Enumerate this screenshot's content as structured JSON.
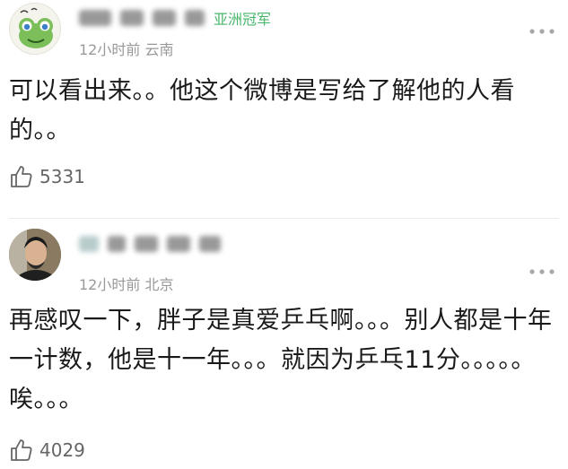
{
  "comments": [
    {
      "user_badge": "亚洲冠军",
      "time": "12小时前",
      "location": "云南",
      "text": "可以看出来。。他这个微博是写给了解他的人看的。。",
      "likes": "5331"
    },
    {
      "user_badge": "",
      "time": "12小时前",
      "location": "北京",
      "text": "再感叹一下，胖子是真爱乒乓啊。。。别人都是十年一计数，他是十一年。。。就因为乒乓11分。。。。。唉。。。",
      "likes": "4029"
    }
  ],
  "icons": {
    "more": "more-dots-icon",
    "like": "thumbs-up-icon"
  },
  "colors": {
    "badge": "#49b66b",
    "meta": "#999999",
    "text": "#1a1a1a"
  }
}
